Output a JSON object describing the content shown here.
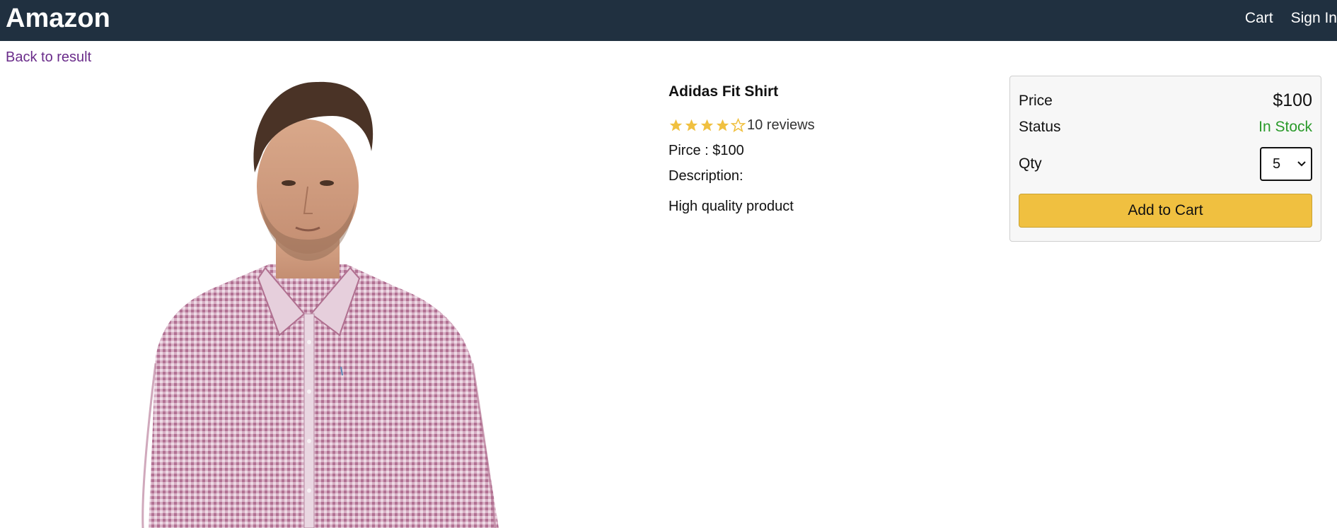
{
  "header": {
    "brand": "Amazon",
    "nav": {
      "cart": "Cart",
      "sign_in": "Sign In"
    },
    "background": "#203040"
  },
  "back_link": "Back to result",
  "product": {
    "name": "Adidas Fit Shirt",
    "rating": 4,
    "rating_max": 5,
    "reviews": "10 reviews",
    "price_line": "Pirce : $100",
    "description_label": "Description:",
    "description": "High quality product",
    "image": "man-wearing-pink-checked-shirt"
  },
  "buybox": {
    "price_label": "Price",
    "price_value": "$100",
    "status_label": "Status",
    "status_value": "In Stock",
    "qty_label": "Qty",
    "qty_value": "5",
    "add_to_cart": "Add to Cart"
  },
  "colors": {
    "star": "#f0c040",
    "status_green": "#2a9a2a",
    "button": "#f0c040",
    "link_purple": "#6a2c8a"
  }
}
